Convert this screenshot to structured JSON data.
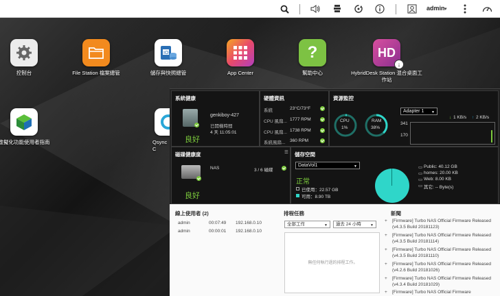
{
  "topbar": {
    "icons": [
      "search-icon",
      "volume-icon",
      "tasks-icon",
      "sync-icon",
      "info-icon",
      "user-icon",
      "more-icon",
      "dashboard-icon"
    ],
    "user_label": "admin",
    "user_caret": "▾"
  },
  "desktop": {
    "apps": [
      {
        "label": "控制台",
        "icon": "gear-icon",
        "color": "#e8e8e8"
      },
      {
        "label": "File Station 檔案總管",
        "icon": "folder-icon",
        "color": "#f28a1e"
      },
      {
        "label": "儲存與快照總管",
        "icon": "storage-icon",
        "color": "#ffffff"
      },
      {
        "label": "App Center",
        "icon": "app-grid-icon",
        "color": "#e84a6a"
      },
      {
        "label": "幫助中心",
        "icon": "help-icon",
        "color": "#7dc243"
      },
      {
        "label": "HybridDesk Station 混合桌面工作站",
        "icon": "hd-icon",
        "color": "#c43fa1"
      },
      {
        "label": "虛擬化功能使用者指南",
        "icon": "virtualization-icon",
        "color": "#ffffff"
      },
      {
        "label": "Qsync C",
        "icon": "qsync-icon",
        "color": "#ffffff"
      }
    ]
  },
  "dashboard": {
    "system_health": {
      "title": "系統健康",
      "hostname": "genkiboy-427",
      "uptime_label": "已開機時間",
      "uptime_value": "4 天 11:05:01",
      "status": "良好"
    },
    "hardware": {
      "title": "硬體資訊",
      "rows": [
        {
          "label": "系統",
          "value": "23°C/73°F"
        },
        {
          "label": "CPU 風扇...",
          "value": "1777 RPM"
        },
        {
          "label": "CPU 風扇...",
          "value": "1738 RPM"
        },
        {
          "label": "系統風扇...",
          "value": "360 RPM"
        }
      ]
    },
    "resource": {
      "title": "資源監控",
      "cpu_label": "CPU",
      "cpu_value": "1%",
      "cpu_fraction": 0.01,
      "ram_label": "RAM",
      "ram_value": "38%",
      "ram_fraction": 0.38,
      "adapter": "Adapter 1",
      "down_label": "1 KB/s",
      "up_label": "2 KB/s",
      "y_top": "341",
      "y_mid": "170"
    },
    "disk_health": {
      "title": "磁碟健康度",
      "disk_label": "NAS",
      "disk_count": "3 / 6 磁碟",
      "status": "良好"
    },
    "storage": {
      "title": "儲存空間",
      "volume": "DataVol1",
      "status": "正常",
      "used": "已使用：22.57 GB",
      "free": "可用：8.90 TB",
      "legend": [
        {
          "label": "Public: 40.12 GB"
        },
        {
          "label": "homes: 20.00 KB"
        },
        {
          "label": "Web: 8.00 KB"
        },
        {
          "label": "其它: -- Byte(s)"
        }
      ]
    }
  },
  "lower": {
    "online_users": {
      "title": "線上使用者 (2)",
      "rows": [
        {
          "user": "admin",
          "time": "00:07:49",
          "ip": "192.168.0.10"
        },
        {
          "user": "admin",
          "time": "00:00:01",
          "ip": "192.168.0.10"
        }
      ]
    },
    "scheduled": {
      "title": "排程任務",
      "filter": "全部工作",
      "range": "過去 24 小時",
      "empty": "無任何執行過的排程工作。"
    },
    "news": {
      "title": "新聞",
      "items": [
        "[Firmware] Turbo NAS Official Firmware Released (v4.3.5 Build 20181123)",
        "[Firmware] Turbo NAS Official Firmware Released (v4.3.5 Build 20181114)",
        "[Firmware] Turbo NAS Official Firmware Released (v4.3.5 Build 20181110)",
        "[Firmware] Turbo NAS Official Firmware Released (v4.2.6 Build 20181026)",
        "[Firmware] Turbo NAS Official Firmware Released (v4.3.4 Build 20181029)",
        "[Firmware] Turbo NAS Official Firmware"
      ]
    }
  }
}
